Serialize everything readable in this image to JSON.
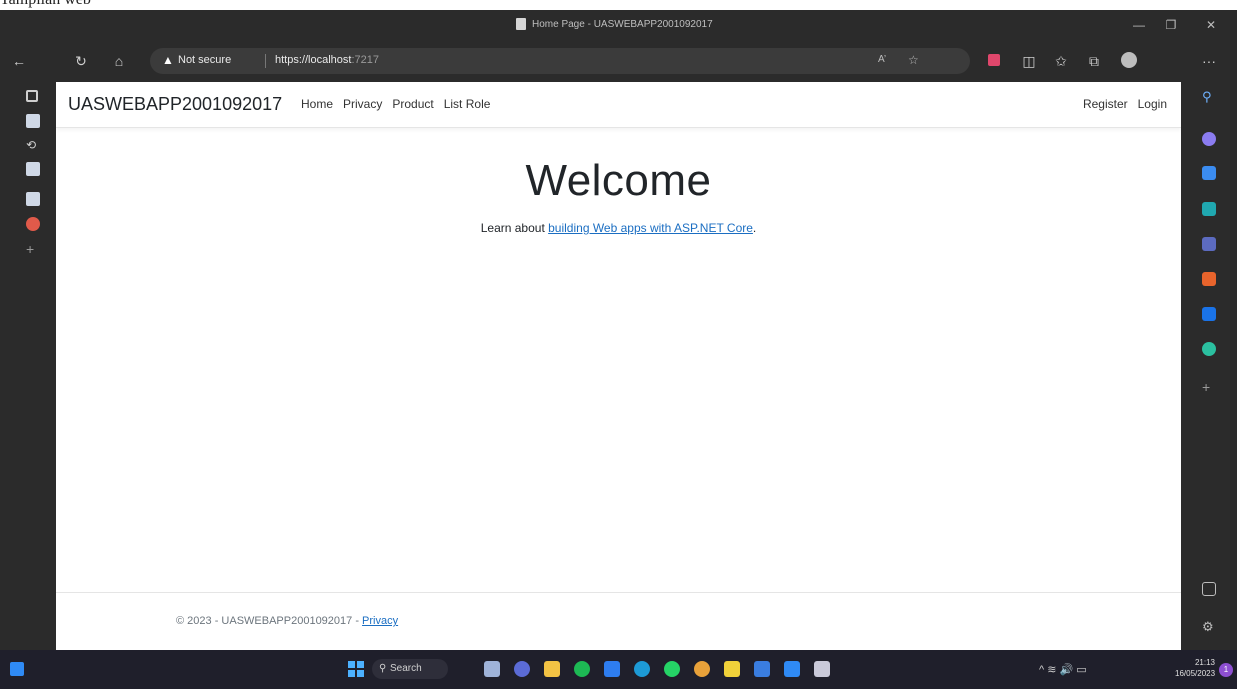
{
  "caption": "Tampilan web",
  "window": {
    "title": "Home Page - UASWEBAPP2001092017",
    "minimize_glyph": "—",
    "maximize_glyph": "❐",
    "close_glyph": "✕"
  },
  "toolbar": {
    "security_text": "Not secure",
    "url_scheme_host": "https://localhost",
    "url_port": ":7217",
    "read_aloud": "A’",
    "more_glyph": "···"
  },
  "navbar": {
    "brand": "UASWEBAPP2001092017",
    "links": [
      "Home",
      "Privacy",
      "Product",
      "List Role"
    ],
    "right_links": [
      "Register",
      "Login"
    ]
  },
  "main": {
    "heading": "Welcome",
    "learn_prefix": "Learn about ",
    "learn_link": "building Web apps with ASP.NET Core",
    "learn_suffix": "."
  },
  "footer": {
    "copyright": "© 2023 - UASWEBAPP2001092017 - ",
    "privacy_link": "Privacy"
  },
  "taskbar": {
    "search_label": "Search",
    "tray_text": "^  ≋  🔊  ▭",
    "time": "21:13",
    "date": "16/05/2023",
    "notification_count": "1"
  },
  "colors": {
    "chrome": "#2b2b2b",
    "link": "#1b6ec2",
    "taskbar": "#1f1f2b"
  }
}
